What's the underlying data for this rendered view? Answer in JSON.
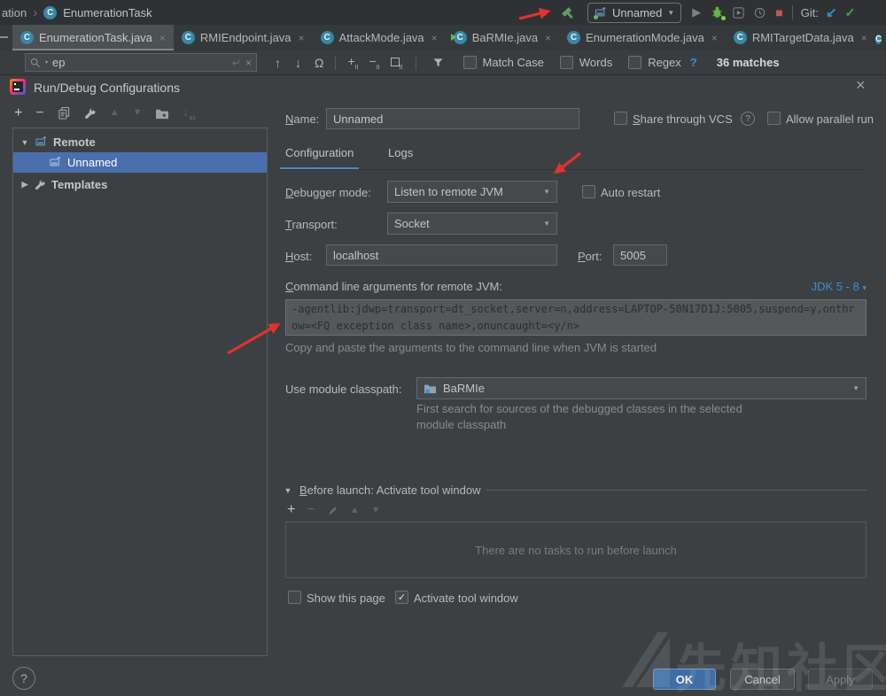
{
  "colors": {
    "accent_blue": "#4a88c7",
    "selection_blue": "#4b6eaf",
    "link_blue": "#3d8fd1",
    "ok_button_blue": "#3d6ea5",
    "stop_red": "#c75450",
    "annotation_arrow_red": "#df332f",
    "hammer_green": "#5f9e60",
    "bug_green": "#62b543",
    "git_check_green": "#4f9e58",
    "git_arrow_blue": "#3592c4",
    "class_icon_teal": "#3987a6"
  },
  "icons": {
    "class_letter": "C",
    "close": "×",
    "breadcrumb_chevron": "›",
    "dropdown_caret": "▼",
    "small_caret": "▾",
    "tree_expanded": "▼",
    "tree_collapsed": "▶",
    "play": "▶",
    "stop": "■",
    "git_update": "↙",
    "git_commit_check": "✓",
    "prev_occurrence": "↑",
    "next_occurrence": "↓",
    "find_all": "Ω",
    "enter": "↵",
    "plus": "+",
    "minus": "−",
    "occurrence_suffix": "II",
    "sort_arrow": "↓",
    "sort_suffix": "az",
    "move_up": "▲",
    "move_down": "▼",
    "check": "✓",
    "question": "?"
  },
  "topbar": {
    "breadcrumb_prefix": "ation",
    "breadcrumb_class": "EnumerationTask",
    "run_config_name": "Unnamed",
    "git_label": "Git:"
  },
  "editor_tabs": [
    {
      "label": "EnumerationTask.java"
    },
    {
      "label": "RMIEndpoint.java"
    },
    {
      "label": "AttackMode.java"
    },
    {
      "label": "BaRMIe.java"
    },
    {
      "label": "EnumerationMode.java"
    },
    {
      "label": "RMITargetData.java"
    }
  ],
  "find_bar": {
    "query": "ep",
    "match_case_label": "Match Case",
    "words_label": "Words",
    "regex_label": "Regex",
    "matches_text": "36 matches"
  },
  "dialog": {
    "title": "Run/Debug Configurations",
    "tree": {
      "group_remote": "Remote",
      "item_unnamed": "Unnamed",
      "group_templates": "Templates"
    },
    "name_label": "Name:",
    "name_value": "Unnamed",
    "share_vcs_label": "Share through VCS",
    "allow_parallel_label": "Allow parallel run",
    "tab_configuration": "Configuration",
    "tab_logs": "Logs",
    "debugger_mode_label": "Debugger mode:",
    "debugger_mode_value": "Listen to remote JVM",
    "auto_restart_label": "Auto restart",
    "transport_label": "Transport:",
    "transport_value": "Socket",
    "host_label": "Host:",
    "host_value": "localhost",
    "port_label": "Port:",
    "port_value": "5005",
    "cmd_args_label": "Command line arguments for remote JVM:",
    "jdk_link": "JDK 5 - 8",
    "cmd_args_value": "-agentlib:jdwp=transport=dt_socket,server=n,address=LAPTOP-50N17D1J:5005,suspend=y,onthrow=<FQ exception class name>,onuncaught=<y/n>",
    "cmd_args_hint": "Copy and paste the arguments to the command line when JVM is started",
    "module_label": "Use module classpath:",
    "module_value": "BaRMIe",
    "module_hint": "First search for sources of the debugged classes in the selected module classpath",
    "before_launch_label": "Before launch: Activate tool window",
    "no_tasks_text": "There are no tasks to run before launch",
    "show_page_label": "Show this page",
    "activate_tw_label": "Activate tool window",
    "ok_label": "OK",
    "cancel_label": "Cancel",
    "apply_label": "Apply"
  },
  "watermark": {
    "text": "先知社区"
  }
}
